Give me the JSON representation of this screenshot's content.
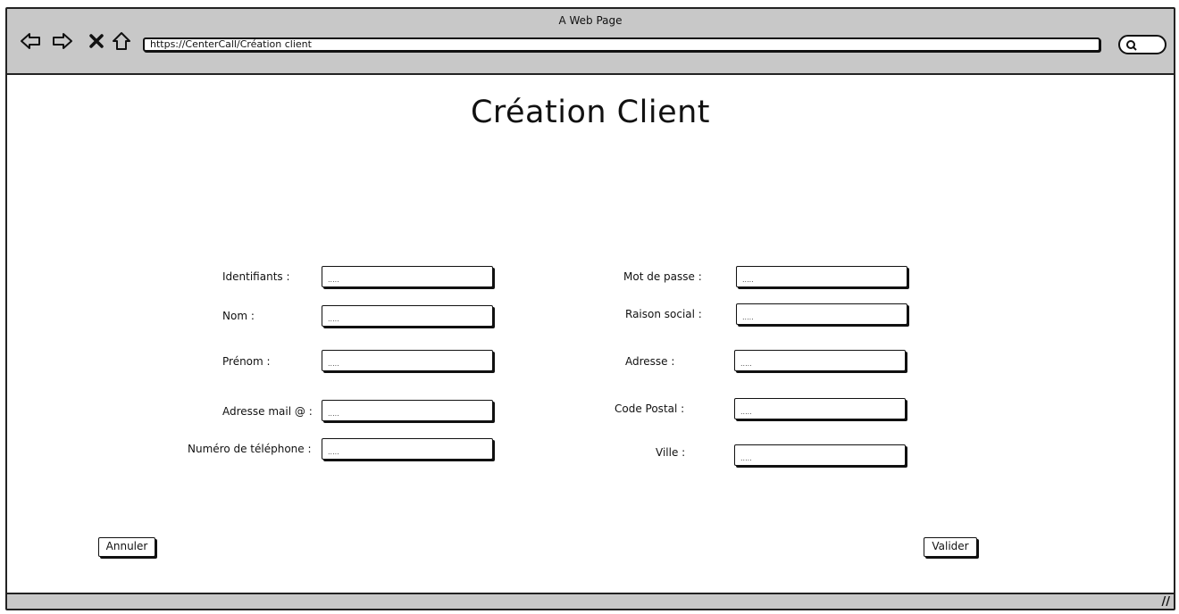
{
  "window": {
    "title": "A Web Page",
    "url": "https://CenterCall/Création client"
  },
  "icons": {
    "back": "arrow-left-icon",
    "forward": "arrow-right-icon",
    "stop": "close-icon",
    "home": "home-icon",
    "search": "search-icon",
    "resize": "resize-grip-icon"
  },
  "page": {
    "title": "Création Client"
  },
  "form": {
    "left": [
      {
        "label": "Identifiants :",
        "value": "....."
      },
      {
        "label": "Nom :",
        "value": "....."
      },
      {
        "label": "Prénom :",
        "value": "....."
      },
      {
        "label": "Adresse mail @ :",
        "value": "....."
      },
      {
        "label": "Numéro de téléphone :",
        "value": "....."
      }
    ],
    "right": [
      {
        "label": "Mot de passe :",
        "value": "....."
      },
      {
        "label": "Raison social :",
        "value": "....."
      },
      {
        "label": "Adresse :",
        "value": "....."
      },
      {
        "label": "Code Postal :",
        "value": "....."
      },
      {
        "label": "Ville :",
        "value": "....."
      }
    ]
  },
  "buttons": {
    "cancel": "Annuler",
    "submit": "Valider"
  },
  "statusbar": {
    "grip": "//"
  }
}
